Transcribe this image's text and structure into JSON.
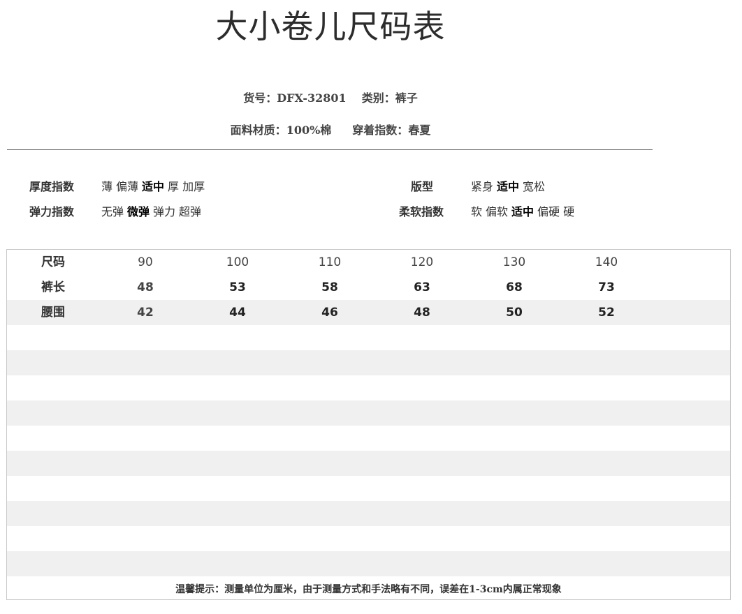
{
  "title": "大小卷儿尺码表",
  "meta": {
    "item_no_label": "货号：",
    "item_no_value": "DFX-32801",
    "category_label": "类别：",
    "category_value": "裤子",
    "material_label": "面料材质：",
    "material_value": "100%棉",
    "season_label": "穿着指数：",
    "season_value": "春夏"
  },
  "attributes": {
    "thickness": {
      "label": "厚度指数",
      "options": [
        "薄",
        "偏薄",
        "适中",
        "厚",
        "加厚"
      ],
      "selected": "适中"
    },
    "elasticity": {
      "label": "弹力指数",
      "options": [
        "无弹",
        "微弹",
        "弹力",
        "超弹"
      ],
      "selected": "微弹"
    },
    "fit": {
      "label": "版型",
      "options": [
        "紧身",
        "适中",
        "宽松"
      ],
      "selected": "适中"
    },
    "softness": {
      "label": "柔软指数",
      "options": [
        "软",
        "偏软",
        "适中",
        "偏硬",
        "硬"
      ],
      "selected": "适中"
    }
  },
  "size_table": {
    "rows": [
      {
        "label": "尺码",
        "values": [
          "90",
          "100",
          "110",
          "120",
          "130",
          "140"
        ]
      },
      {
        "label": "裤长",
        "values": [
          "48",
          "53",
          "58",
          "63",
          "68",
          "73"
        ]
      },
      {
        "label": "腰围",
        "values": [
          "42",
          "44",
          "46",
          "48",
          "50",
          "52"
        ]
      }
    ]
  },
  "note": "温馨提示：测量单位为厘米，由于测量方式和手法略有不同，误差在1-3cm内属正常现象",
  "colors": {
    "band": "#f0f0f0",
    "text": "#333333",
    "border": "#c8c8c8"
  }
}
